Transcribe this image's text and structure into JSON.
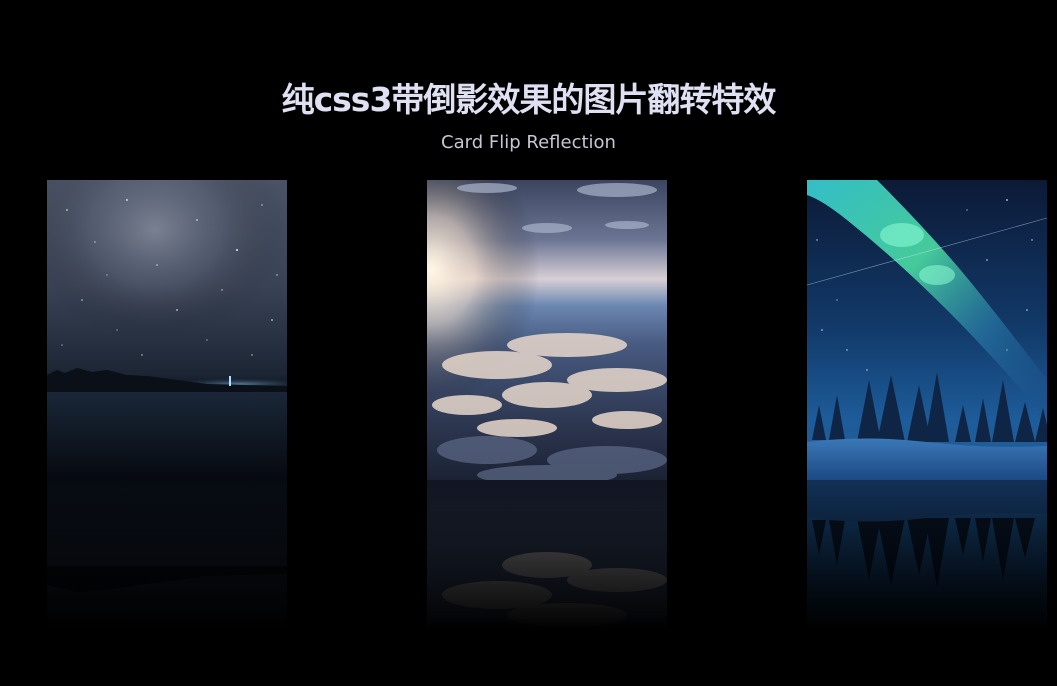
{
  "header": {
    "title": "纯css3带倒影效果的图片翻转特效",
    "subtitle": "Card Flip Reflection"
  },
  "cards": [
    {
      "name": "starry-night-lake"
    },
    {
      "name": "sunset-above-clouds"
    },
    {
      "name": "aurora-milky-way-forest"
    }
  ],
  "colors": {
    "background": "#000000",
    "title": "#dfe0f2",
    "subtitle": "#c7c7d3"
  }
}
